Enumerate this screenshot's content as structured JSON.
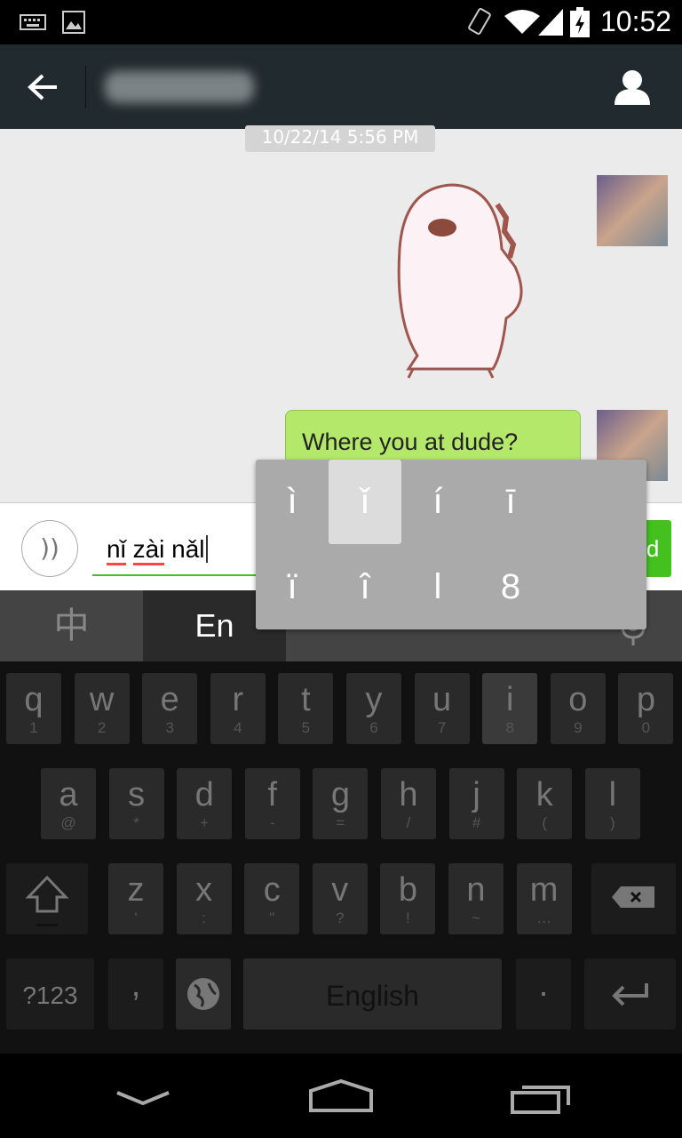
{
  "status": {
    "time": "10:52",
    "icons": [
      "keyboard-icon",
      "image-icon",
      "vibrate-icon",
      "wifi-icon",
      "signal-icon",
      "battery-charging-icon"
    ]
  },
  "header": {
    "back_icon": "arrow-left-icon",
    "contact_icon": "person-icon"
  },
  "chat": {
    "timestamp": "10/22/14 5:56 PM",
    "messages": [
      {
        "type": "sticker"
      },
      {
        "type": "text",
        "text": "Where you at dude?"
      }
    ]
  },
  "input": {
    "value_words": [
      "nǐ",
      "zài",
      "nǎl"
    ],
    "send_label": "Send",
    "bubble_color": "#b4e86a",
    "send_color": "#44c01f"
  },
  "candidates": {
    "chinese_tab": "中",
    "english_tab": "En"
  },
  "popup": {
    "chars": [
      "ì",
      "ǐ",
      "í",
      "ī",
      "ï",
      "î",
      "l",
      "8"
    ],
    "selected": "ǐ"
  },
  "keyboard": {
    "row1": [
      [
        "q",
        "1"
      ],
      [
        "w",
        "2"
      ],
      [
        "e",
        "3"
      ],
      [
        "r",
        "4"
      ],
      [
        "t",
        "5"
      ],
      [
        "y",
        "6"
      ],
      [
        "u",
        "7"
      ],
      [
        "i",
        "8"
      ],
      [
        "o",
        "9"
      ],
      [
        "p",
        "0"
      ]
    ],
    "row2": [
      [
        "a",
        "@"
      ],
      [
        "s",
        "*"
      ],
      [
        "d",
        "+"
      ],
      [
        "f",
        "-"
      ],
      [
        "g",
        "="
      ],
      [
        "h",
        "/"
      ],
      [
        "j",
        "#"
      ],
      [
        "k",
        "("
      ],
      [
        "l",
        ")"
      ]
    ],
    "row3": [
      [
        "z",
        "'"
      ],
      [
        "x",
        ":"
      ],
      [
        "c",
        "\""
      ],
      [
        "v",
        "?"
      ],
      [
        "b",
        "!"
      ],
      [
        "n",
        "~"
      ],
      [
        "m",
        "…"
      ]
    ],
    "symbols_label": "?123",
    "comma": ",",
    "space_label": "English",
    "period": "."
  }
}
